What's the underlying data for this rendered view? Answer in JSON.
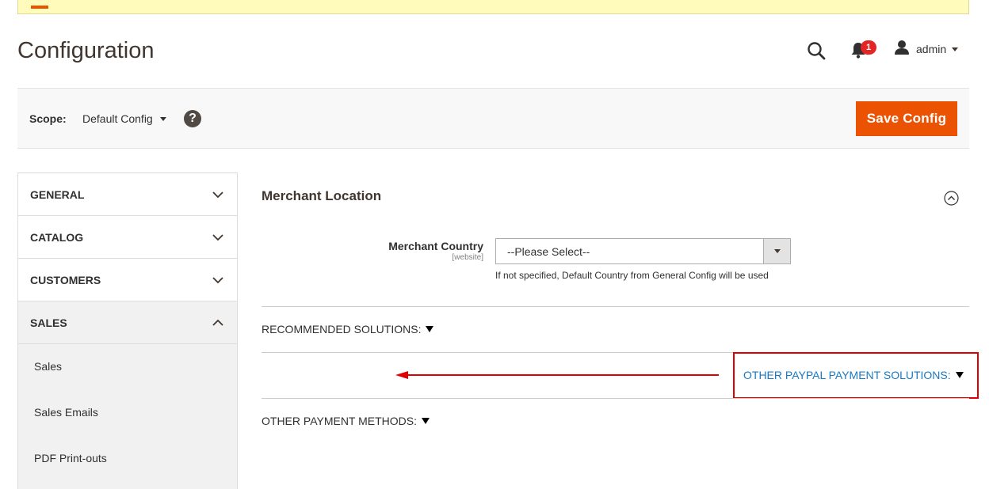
{
  "page": {
    "title": "Configuration"
  },
  "header": {
    "notifications_count": "1",
    "user": "admin"
  },
  "scope": {
    "label": "Scope:",
    "value": "Default Config",
    "help_symbol": "?",
    "save_label": "Save Config"
  },
  "sidebar": {
    "sections": [
      {
        "label": "GENERAL",
        "expanded": false
      },
      {
        "label": "CATALOG",
        "expanded": false
      },
      {
        "label": "CUSTOMERS",
        "expanded": false
      },
      {
        "label": "SALES",
        "expanded": true
      }
    ],
    "sales_items": [
      {
        "label": "Sales"
      },
      {
        "label": "Sales Emails"
      },
      {
        "label": "PDF Print-outs"
      }
    ]
  },
  "main": {
    "section_title": "Merchant Location",
    "merchant_country": {
      "label": "Merchant Country",
      "scope": "[website]",
      "value": "--Please Select--",
      "note": "If not specified, Default Country from General Config will be used"
    },
    "solutions": {
      "recommended": "RECOMMENDED SOLUTIONS:",
      "other_paypal": "OTHER PAYPAL PAYMENT SOLUTIONS:",
      "other_methods": "OTHER PAYMENT METHODS:"
    }
  },
  "colors": {
    "accent": "#eb5202",
    "link": "#1979c3",
    "highlight": "#e00000",
    "badge": "#e22626"
  }
}
